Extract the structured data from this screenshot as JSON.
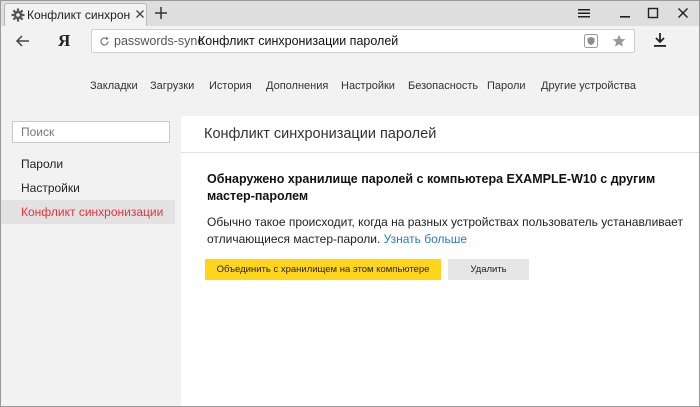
{
  "colors": {
    "accent_yellow": "#ffd51a",
    "active_red": "#e5333b",
    "link_blue": "#2a79c8",
    "chrome_gray": "#f2f2f2"
  },
  "tab": {
    "title": "Конфликт синхронизаци",
    "icon": "gear-icon"
  },
  "window_controls": {
    "menu_icon": "hamburger-icon",
    "minimize_icon": "minimize-icon",
    "maximize_icon": "maximize-icon",
    "close_icon": "close-icon"
  },
  "address_bar": {
    "brand": "Я",
    "url_prefix": "passwords-sync",
    "page_title": "Конфликт синхронизации паролей"
  },
  "settings_nav": [
    "Закладки",
    "Загрузки",
    "История",
    "Дополнения",
    "Настройки",
    "Безопасность",
    "Пароли",
    "Другие устройства"
  ],
  "sidebar": {
    "search_placeholder": "Поиск",
    "items": [
      {
        "label": "Пароли"
      },
      {
        "label": "Настройки"
      },
      {
        "label": "Конфликт синхронизации"
      }
    ]
  },
  "main": {
    "title": "Конфликт синхронизации паролей",
    "headline": "Обнаружено хранилище паролей с компьютера  EXAMPLE-W10 с другим мастер-паролем",
    "description": "Обычно  такое происходит, когда на разных устройствах пользователь устанавливает отличающиеся мастер-пароли.",
    "learn_more": "Узнать больше",
    "merge_button": "Объединить с хранилищем на этом компьютере",
    "delete_button": "Удалить"
  }
}
